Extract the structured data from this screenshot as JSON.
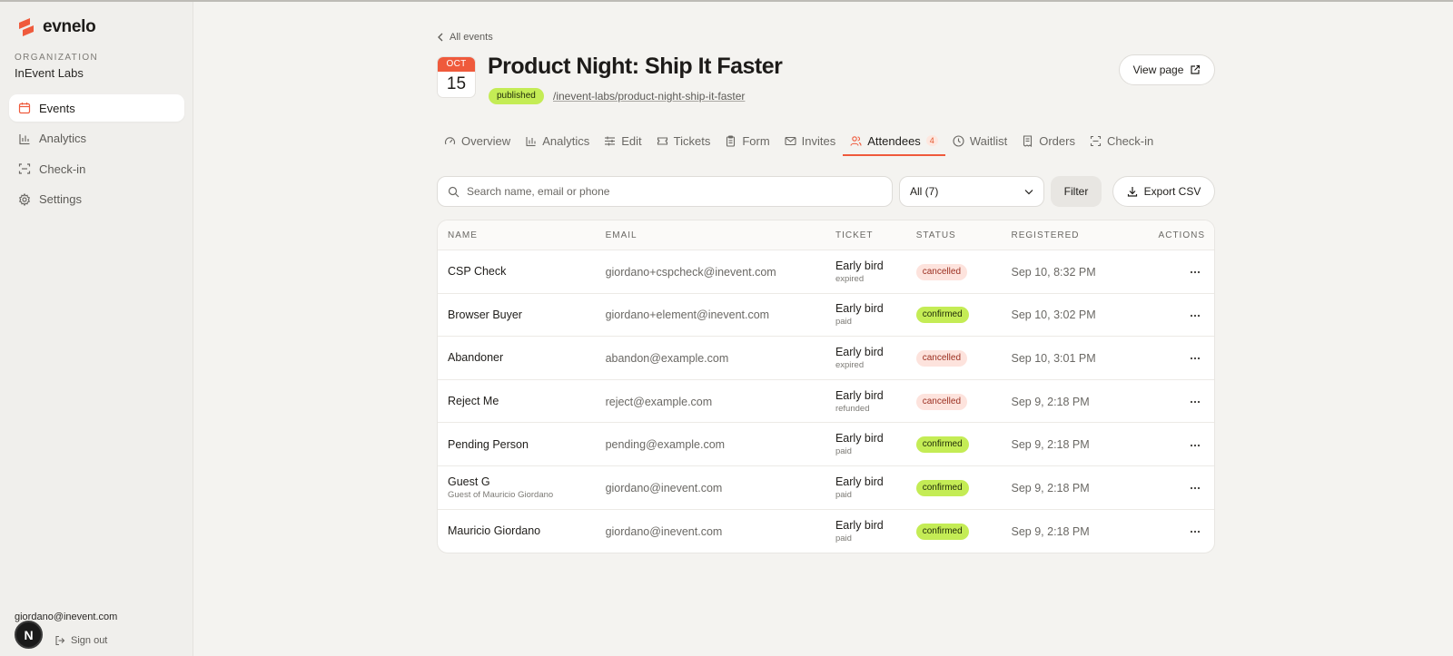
{
  "brand": {
    "name": "evnelo",
    "accent": "#ef5a3c"
  },
  "organization": {
    "label": "ORGANIZATION",
    "name": "InEvent Labs"
  },
  "nav": [
    {
      "label": "Events",
      "icon": "calendar-icon",
      "active": true
    },
    {
      "label": "Analytics",
      "icon": "bar-chart-icon",
      "active": false
    },
    {
      "label": "Check-in",
      "icon": "scan-icon",
      "active": false
    },
    {
      "label": "Settings",
      "icon": "gear-icon",
      "active": false
    }
  ],
  "user": {
    "email": "giordano@inevent.com",
    "avatar_letter": "N",
    "signout_label": "Sign out"
  },
  "event": {
    "back_label": "All events",
    "month": "OCT",
    "day": "15",
    "title": "Product Night: Ship It Faster",
    "status": "published",
    "slug": "/inevent-labs/product-night-ship-it-faster",
    "view_page_label": "View page"
  },
  "tabs": [
    {
      "label": "Overview",
      "icon": "gauge-icon"
    },
    {
      "label": "Analytics",
      "icon": "bar-chart-icon"
    },
    {
      "label": "Edit",
      "icon": "sliders-icon"
    },
    {
      "label": "Tickets",
      "icon": "ticket-icon"
    },
    {
      "label": "Form",
      "icon": "clipboard-icon"
    },
    {
      "label": "Invites",
      "icon": "mail-icon"
    },
    {
      "label": "Attendees",
      "icon": "users-icon",
      "count": "4",
      "active": true
    },
    {
      "label": "Waitlist",
      "icon": "clock-icon"
    },
    {
      "label": "Orders",
      "icon": "receipt-icon"
    },
    {
      "label": "Check-in",
      "icon": "scan-icon"
    }
  ],
  "toolbar": {
    "search_placeholder": "Search name, email or phone",
    "select_value": "All (7)",
    "filter_label": "Filter",
    "export_label": "Export CSV"
  },
  "table": {
    "columns": [
      "NAME",
      "EMAIL",
      "TICKET",
      "STATUS",
      "REGISTERED",
      "ACTIONS"
    ],
    "rows": [
      {
        "name": "CSP Check",
        "sub": "",
        "email": "giordano+cspcheck@inevent.com",
        "ticket": "Early bird",
        "ticket_status": "expired",
        "status": "cancelled",
        "registered": "Sep 10, 8:32 PM"
      },
      {
        "name": "Browser Buyer",
        "sub": "",
        "email": "giordano+element@inevent.com",
        "ticket": "Early bird",
        "ticket_status": "paid",
        "status": "confirmed",
        "registered": "Sep 10, 3:02 PM"
      },
      {
        "name": "Abandoner",
        "sub": "",
        "email": "abandon@example.com",
        "ticket": "Early bird",
        "ticket_status": "expired",
        "status": "cancelled",
        "registered": "Sep 10, 3:01 PM"
      },
      {
        "name": "Reject Me",
        "sub": "",
        "email": "reject@example.com",
        "ticket": "Early bird",
        "ticket_status": "refunded",
        "status": "cancelled",
        "registered": "Sep 9, 2:18 PM"
      },
      {
        "name": "Pending Person",
        "sub": "",
        "email": "pending@example.com",
        "ticket": "Early bird",
        "ticket_status": "paid",
        "status": "confirmed",
        "registered": "Sep 9, 2:18 PM"
      },
      {
        "name": "Guest G",
        "sub": "Guest of Mauricio Giordano",
        "email": "giordano@inevent.com",
        "ticket": "Early bird",
        "ticket_status": "paid",
        "status": "confirmed",
        "registered": "Sep 9, 2:18 PM"
      },
      {
        "name": "Mauricio Giordano",
        "sub": "",
        "email": "giordano@inevent.com",
        "ticket": "Early bird",
        "ticket_status": "paid",
        "status": "confirmed",
        "registered": "Sep 9, 2:18 PM"
      }
    ]
  }
}
